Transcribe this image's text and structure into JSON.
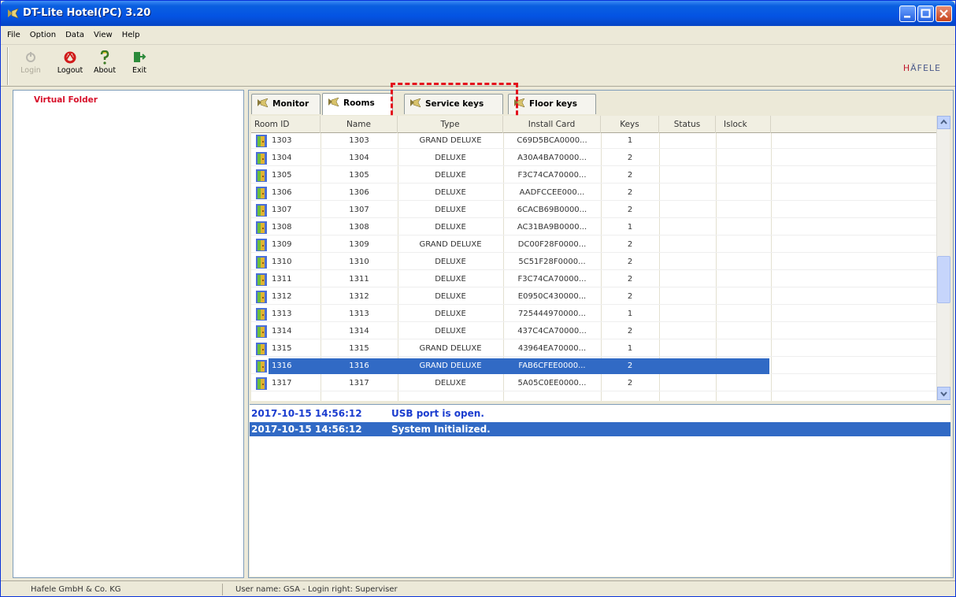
{
  "window": {
    "title": "DT-Lite Hotel(PC) 3.20"
  },
  "menu": [
    "File",
    "Option",
    "Data",
    "View",
    "Help"
  ],
  "toolbar": {
    "buttons": [
      {
        "label": "Login",
        "icon": "login-icon",
        "enabled": false
      },
      {
        "label": "Logout",
        "icon": "logout-icon",
        "enabled": true
      },
      {
        "label": "About",
        "icon": "about-icon",
        "enabled": true
      },
      {
        "label": "Exit",
        "icon": "exit-icon",
        "enabled": true
      }
    ],
    "brand": "HÄFELE"
  },
  "tree": {
    "root": "Virtual Folder"
  },
  "tabs": [
    "Monitor",
    "Rooms",
    "Service keys",
    "Floor keys"
  ],
  "grid": {
    "headers": [
      "Room ID",
      "Name",
      "Type",
      "Install Card",
      "Keys",
      "Status",
      "Islock"
    ],
    "rows": [
      [
        "1303",
        "1303",
        "GRAND DELUXE",
        "C69D5BCA0000...",
        "1",
        "",
        ""
      ],
      [
        "1304",
        "1304",
        "DELUXE",
        "A30A4BA70000...",
        "2",
        "",
        ""
      ],
      [
        "1305",
        "1305",
        "DELUXE",
        "F3C74CA70000...",
        "2",
        "",
        ""
      ],
      [
        "1306",
        "1306",
        "DELUXE",
        "AADFCCEE000...",
        "2",
        "",
        ""
      ],
      [
        "1307",
        "1307",
        "DELUXE",
        "6CACB69B0000...",
        "2",
        "",
        ""
      ],
      [
        "1308",
        "1308",
        "DELUXE",
        "AC31BA9B0000...",
        "1",
        "",
        ""
      ],
      [
        "1309",
        "1309",
        "GRAND DELUXE",
        "DC00F28F0000...",
        "2",
        "",
        ""
      ],
      [
        "1310",
        "1310",
        "DELUXE",
        "5C51F28F0000...",
        "2",
        "",
        ""
      ],
      [
        "1311",
        "1311",
        "DELUXE",
        "F3C74CA70000...",
        "2",
        "",
        ""
      ],
      [
        "1312",
        "1312",
        "DELUXE",
        "E0950C430000...",
        "2",
        "",
        ""
      ],
      [
        "1313",
        "1313",
        "DELUXE",
        "725444970000...",
        "1",
        "",
        ""
      ],
      [
        "1314",
        "1314",
        "DELUXE",
        "437C4CA70000...",
        "2",
        "",
        ""
      ],
      [
        "1315",
        "1315",
        "GRAND DELUXE",
        "43964EA70000...",
        "1",
        "",
        ""
      ],
      [
        "1316",
        "1316",
        "GRAND DELUXE",
        "FAB6CFEE0000...",
        "2",
        "",
        ""
      ],
      [
        "1317",
        "1317",
        "DELUXE",
        "5A05C0EE0000...",
        "2",
        "",
        ""
      ]
    ],
    "selected_row": 13
  },
  "log": [
    {
      "time": "2017-10-15 14:56:12",
      "message": "USB port is open."
    },
    {
      "time": "2017-10-15 14:56:12",
      "message": "System Initialized."
    }
  ],
  "status": {
    "company": "Hafele GmbH & Co. KG",
    "user": "User name: GSA - Login right: Superviser"
  }
}
